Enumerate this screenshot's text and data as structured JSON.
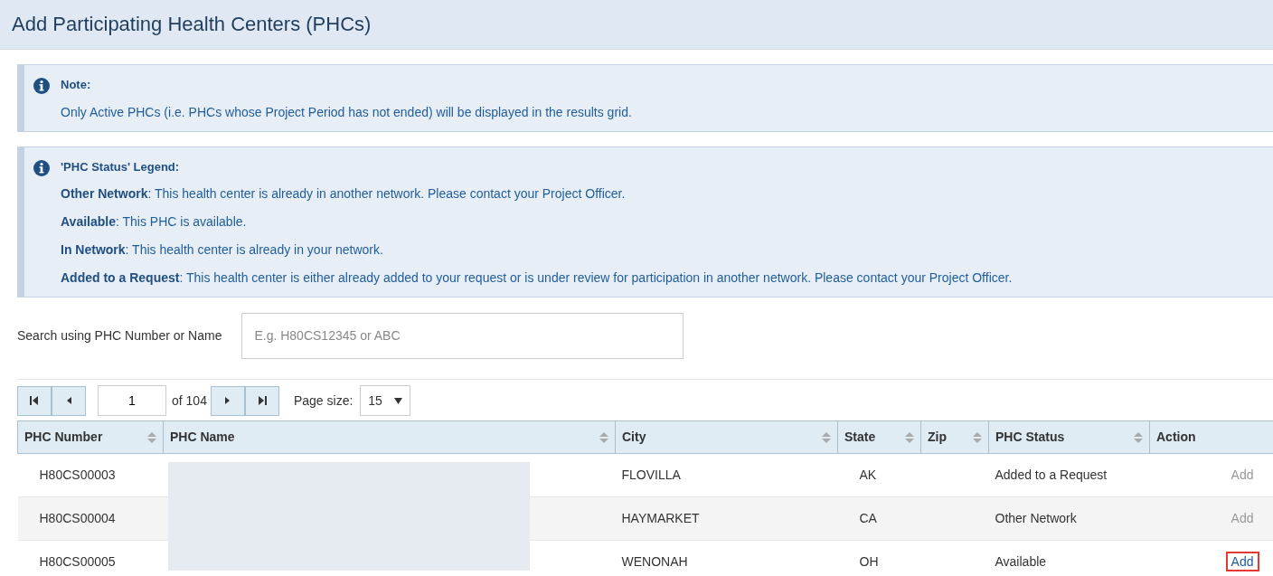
{
  "page_title": "Add Participating Health Centers (PHCs)",
  "note": {
    "title": "Note:",
    "text": "Only Active PHCs (i.e. PHCs whose Project Period has not ended) will be displayed in the results grid."
  },
  "legend": {
    "title": "'PHC Status' Legend:",
    "items": [
      "**Other Network**: This health center is already in another network. Please contact your Project Officer.",
      "**Available**: This PHC is available.",
      "**In Network**: This health center is already in your network.",
      "**Added to a Request**: This health center is either already added to your request or is under review for participation in another network. Please contact your Project Officer."
    ]
  },
  "search": {
    "label": "Search using PHC Number or Name",
    "placeholder": "E.g. H80CS12345 or ABC"
  },
  "pager": {
    "page": "1",
    "of": "of 104",
    "page_size_label": "Page size:",
    "page_size": "15"
  },
  "table": {
    "columns": [
      {
        "label": "PHC Number",
        "sortable": true
      },
      {
        "label": "PHC Name",
        "sortable": true
      },
      {
        "label": "City",
        "sortable": true
      },
      {
        "label": "State",
        "sortable": true
      },
      {
        "label": "Zip",
        "sortable": true
      },
      {
        "label": "PHC Status",
        "sortable": true
      },
      {
        "label": "Action",
        "sortable": false
      }
    ],
    "rows": [
      {
        "number": "H80CS00003",
        "city": "FLOVILLA",
        "state": "AK",
        "status": "Added to a Request",
        "action": {
          "label": "Add",
          "disabled": true,
          "highlighted": false
        }
      },
      {
        "number": "H80CS00004",
        "city": "HAYMARKET",
        "state": "CA",
        "status": "Other Network",
        "action": {
          "label": "Add",
          "disabled": true,
          "highlighted": false
        }
      },
      {
        "number": "H80CS00005",
        "city": "WENONAH",
        "state": "OH",
        "status": "Available",
        "action": {
          "label": "Add",
          "disabled": false,
          "highlighted": true
        }
      }
    ]
  }
}
